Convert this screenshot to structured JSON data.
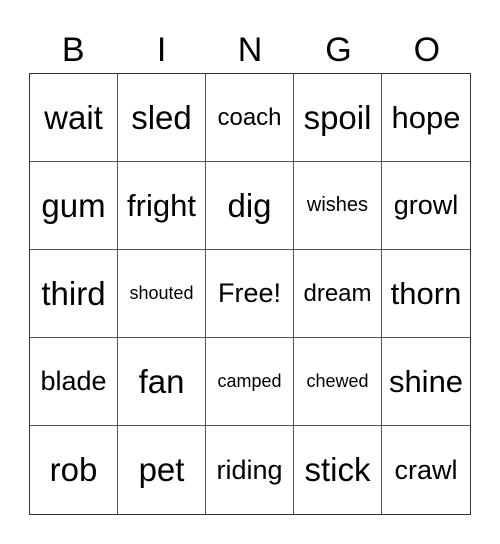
{
  "header": [
    "B",
    "I",
    "N",
    "G",
    "O"
  ],
  "cells": [
    {
      "text": "wait",
      "size": "s-xl"
    },
    {
      "text": "sled",
      "size": "s-xl"
    },
    {
      "text": "coach",
      "size": "s-s"
    },
    {
      "text": "spoil",
      "size": "s-xl"
    },
    {
      "text": "hope",
      "size": "s-l"
    },
    {
      "text": "gum",
      "size": "s-xl"
    },
    {
      "text": "fright",
      "size": "s-l"
    },
    {
      "text": "dig",
      "size": "s-xl"
    },
    {
      "text": "wishes",
      "size": "s-xs"
    },
    {
      "text": "growl",
      "size": "s-m"
    },
    {
      "text": "third",
      "size": "s-xl"
    },
    {
      "text": "shouted",
      "size": "s-xxs"
    },
    {
      "text": "Free!",
      "size": "s-m"
    },
    {
      "text": "dream",
      "size": "s-s"
    },
    {
      "text": "thorn",
      "size": "s-l"
    },
    {
      "text": "blade",
      "size": "s-m"
    },
    {
      "text": "fan",
      "size": "s-xl"
    },
    {
      "text": "camped",
      "size": "s-xxs"
    },
    {
      "text": "chewed",
      "size": "s-xxs"
    },
    {
      "text": "shine",
      "size": "s-l"
    },
    {
      "text": "rob",
      "size": "s-xl"
    },
    {
      "text": "pet",
      "size": "s-xl"
    },
    {
      "text": "riding",
      "size": "s-m"
    },
    {
      "text": "stick",
      "size": "s-xl"
    },
    {
      "text": "crawl",
      "size": "s-m"
    }
  ]
}
